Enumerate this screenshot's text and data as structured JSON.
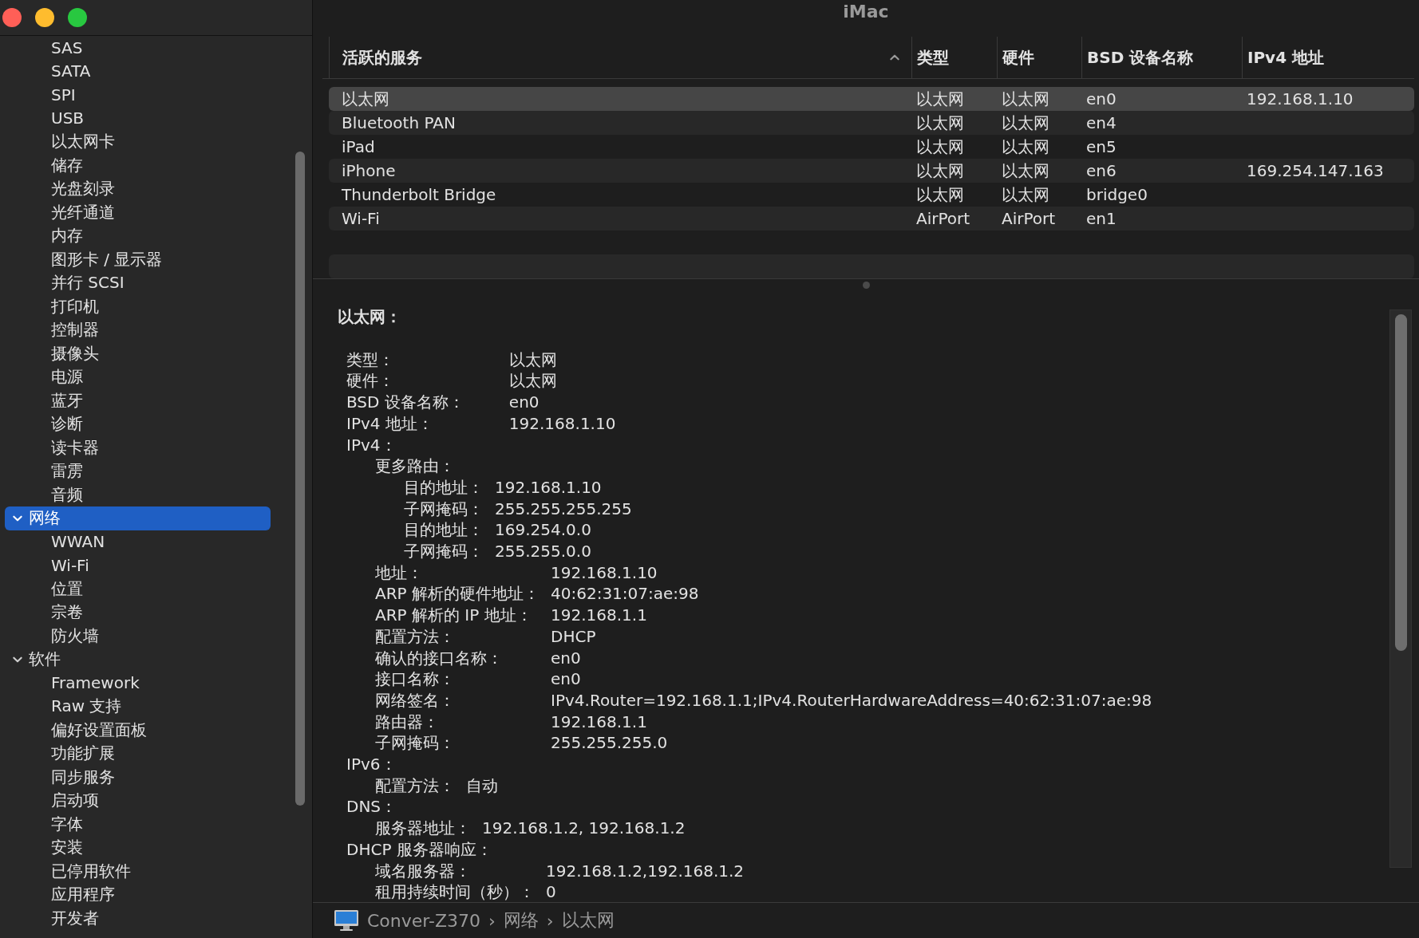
{
  "window": {
    "title": "iMac",
    "controls": [
      {
        "color": "#ff5f57"
      },
      {
        "color": "#febc2e"
      },
      {
        "color": "#28c840"
      }
    ]
  },
  "sidebar": {
    "items": [
      {
        "children": [
          {
            "label": "SAS"
          },
          {
            "label": "SATA"
          },
          {
            "label": "SPI"
          },
          {
            "label": "USB"
          },
          {
            "label": "以太网卡"
          },
          {
            "label": "储存"
          },
          {
            "label": "光盘刻录"
          },
          {
            "label": "光纤通道"
          },
          {
            "label": "内存"
          },
          {
            "label": "图形卡 / 显示器"
          },
          {
            "label": "并行 SCSI"
          },
          {
            "label": "打印机"
          },
          {
            "label": "控制器"
          },
          {
            "label": "摄像头"
          },
          {
            "label": "电源"
          },
          {
            "label": "蓝牙"
          },
          {
            "label": "诊断"
          },
          {
            "label": "读卡器"
          },
          {
            "label": "雷雳"
          },
          {
            "label": "音频"
          }
        ]
      },
      {
        "label": "网络",
        "selected": true,
        "expanded": true,
        "children": [
          {
            "label": "WWAN"
          },
          {
            "label": "Wi-Fi"
          },
          {
            "label": "位置"
          },
          {
            "label": "宗卷"
          },
          {
            "label": "防火墙"
          }
        ]
      },
      {
        "label": "软件",
        "selected": false,
        "expanded": true,
        "children": [
          {
            "label": "Framework"
          },
          {
            "label": "Raw 支持"
          },
          {
            "label": "偏好设置面板"
          },
          {
            "label": "功能扩展"
          },
          {
            "label": "同步服务"
          },
          {
            "label": "启动项"
          },
          {
            "label": "字体"
          },
          {
            "label": "安装"
          },
          {
            "label": "已停用软件"
          },
          {
            "label": "应用程序"
          },
          {
            "label": "开发者"
          }
        ]
      }
    ]
  },
  "table": {
    "columns": [
      {
        "label": "活跃的服务",
        "sorted": true
      },
      {
        "label": "类型",
        "sorted": false
      },
      {
        "label": "硬件",
        "sorted": false
      },
      {
        "label": "BSD 设备名称",
        "sorted": false
      },
      {
        "label": "IPv4 地址",
        "sorted": false
      }
    ],
    "rows": [
      {
        "cells": [
          "以太网",
          "以太网",
          "以太网",
          "en0",
          "192.168.1.10"
        ],
        "selected": true
      },
      {
        "cells": [
          "Bluetooth PAN",
          "以太网",
          "以太网",
          "en4",
          ""
        ],
        "selected": false
      },
      {
        "cells": [
          "iPad",
          "以太网",
          "以太网",
          "en5",
          ""
        ],
        "selected": false
      },
      {
        "cells": [
          "iPhone",
          "以太网",
          "以太网",
          "en6",
          "169.254.147.163"
        ],
        "selected": false
      },
      {
        "cells": [
          "Thunderbolt Bridge",
          "以太网",
          "以太网",
          "bridge0",
          ""
        ],
        "selected": false
      },
      {
        "cells": [
          "Wi-Fi",
          "AirPort",
          "AirPort",
          "en1",
          ""
        ],
        "selected": false
      }
    ]
  },
  "details": {
    "title": "以太网：",
    "fields": [
      {
        "label": "类型：",
        "value": "以太网"
      },
      {
        "label": "硬件：",
        "value": "以太网"
      },
      {
        "label": "BSD 设备名称：",
        "value": "en0"
      },
      {
        "label": "IPv4 地址：",
        "value": "192.168.1.10"
      },
      {
        "label": "IPv4：",
        "children": [
          {
            "label": "更多路由：",
            "children": [
              {
                "label": "目的地址：",
                "value": "192.168.1.10"
              },
              {
                "label": "子网掩码：",
                "value": "255.255.255.255"
              },
              {
                "label": "目的地址：",
                "value": "169.254.0.0"
              },
              {
                "label": "子网掩码：",
                "value": "255.255.0.0"
              }
            ]
          },
          {
            "label": "地址：",
            "value": "192.168.1.10"
          },
          {
            "label": "ARP 解析的硬件地址：",
            "value": "40:62:31:07:ae:98"
          },
          {
            "label": "ARP 解析的 IP 地址：",
            "value": "192.168.1.1"
          },
          {
            "label": "配置方法：",
            "value": "DHCP"
          },
          {
            "label": "确认的接口名称：",
            "value": "en0"
          },
          {
            "label": "接口名称：",
            "value": "en0"
          },
          {
            "label": "网络签名：",
            "value": "IPv4.Router=192.168.1.1;IPv4.RouterHardwareAddress=40:62:31:07:ae:98"
          },
          {
            "label": "路由器：",
            "value": "192.168.1.1"
          },
          {
            "label": "子网掩码：",
            "value": "255.255.255.0"
          }
        ]
      },
      {
        "label": "IPv6：",
        "children": [
          {
            "label": "配置方法：",
            "value": "自动"
          }
        ]
      },
      {
        "label": "DNS：",
        "children": [
          {
            "label": "服务器地址：",
            "value": "192.168.1.2, 192.168.1.2"
          }
        ]
      },
      {
        "label": "DHCP 服务器响应：",
        "children": [
          {
            "label": "域名服务器：",
            "value": "192.168.1.2,192.168.1.2"
          },
          {
            "label": "租用持续时间（秒）：",
            "value": "0"
          }
        ]
      }
    ]
  },
  "path_bar": {
    "items": [
      "Conver-Z370",
      "网络",
      "以太网"
    ],
    "separators": [
      "›",
      "›"
    ]
  }
}
